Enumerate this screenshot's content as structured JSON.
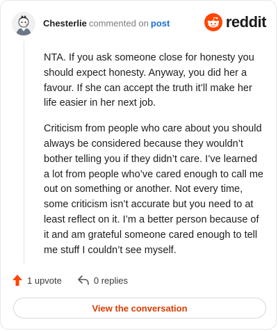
{
  "header": {
    "author": "Chesterlie",
    "action_text": "commented on",
    "post_link": "post",
    "brand_name": "reddit"
  },
  "comment": {
    "paragraphs": [
      "NTA. If you ask someone close for honesty you should expect honesty. Anyway, you did her a favour. If she can accept the truth it’ll make her life easier in her next job.",
      "Criticism from people who care about you should always be considered because they wouldn’t bother telling you if they didn’t care. I’ve learned a lot from people who’ve cared enough to call me out on something or another. Not every time, some criticism isn’t accurate but you need to at least reflect on it. I’m a better person because of it and am grateful someone cared enough to tell me stuff I couldn’t see myself."
    ]
  },
  "actions": {
    "upvotes": "1 upvote",
    "replies": "0 replies"
  },
  "cta": {
    "label": "View the conversation"
  },
  "colors": {
    "accent": "#ff4500",
    "link": "#1a6fd6",
    "cta_text": "#d93a00"
  },
  "icons": [
    "user-avatar-icon",
    "reddit-logo-icon",
    "upvote-arrow-icon",
    "reply-arrow-icon"
  ]
}
